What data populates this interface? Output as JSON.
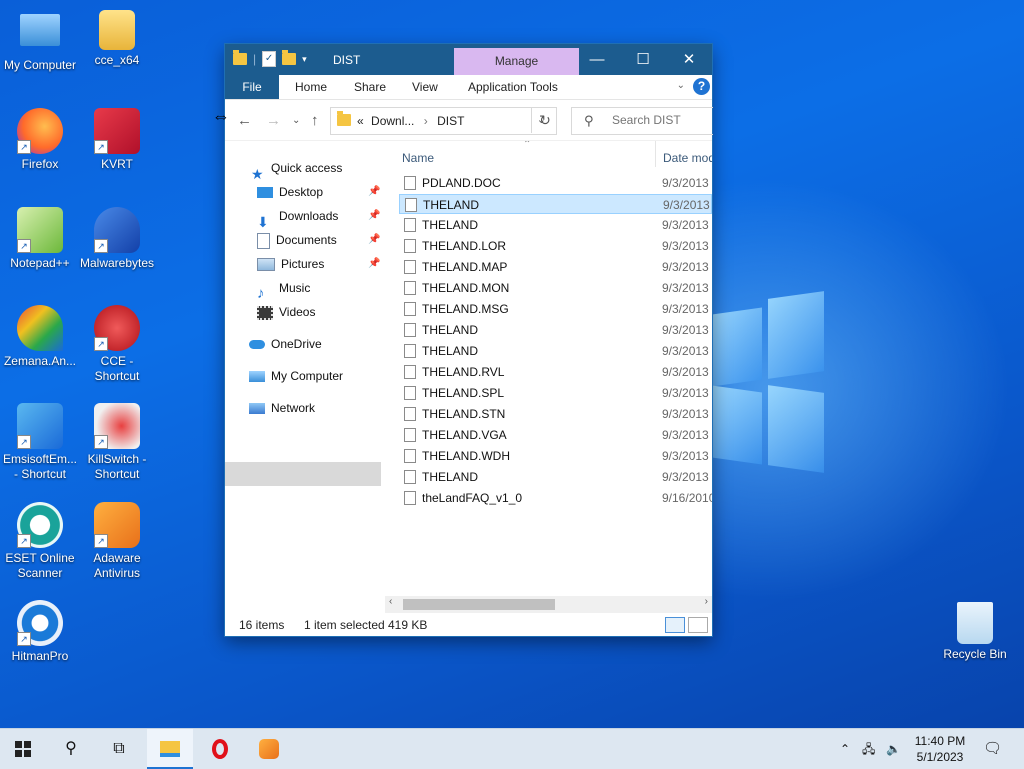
{
  "desktop": {
    "icons": [
      {
        "label": "My Computer",
        "color": "#4aa3e8"
      },
      {
        "label": "cce_x64",
        "color": "#f0c660"
      },
      {
        "label": "Firefox",
        "color": "#e8683a"
      },
      {
        "label": "KVRT",
        "color": "#d2243a"
      },
      {
        "label": "Notepad++",
        "color": "#7cc04e"
      },
      {
        "label": "Malwarebytes",
        "color": "#1b60c8"
      },
      {
        "label": "Zemana.An...",
        "color": "#2e9a4a"
      },
      {
        "label": "CCE - Shortcut",
        "color": "#c8202a"
      },
      {
        "label": "EmsisoftEm... - Shortcut",
        "color": "#2a8ad8"
      },
      {
        "label": "KillSwitch - Shortcut",
        "color": "#c82a2a"
      },
      {
        "label": "ESET Online Scanner",
        "color": "#1aa39a"
      },
      {
        "label": "Adaware Antivirus",
        "color": "#f08a1a"
      },
      {
        "label": "HitmanPro",
        "color": "#1a7ad8"
      },
      {
        "label": "Recycle Bin",
        "color": "#cfe6f7"
      }
    ]
  },
  "explorer": {
    "title": "DIST",
    "manage_label": "Manage",
    "tabs": {
      "file": "File",
      "home": "Home",
      "share": "Share",
      "view": "View",
      "app_tools": "Application Tools"
    },
    "help": "?",
    "address": {
      "prefix": "«",
      "path1": "Downl...",
      "sep": "›",
      "path2": "DIST"
    },
    "search_placeholder": "Search DIST",
    "nav": {
      "quick_access": "Quick access",
      "desktop": "Desktop",
      "downloads": "Downloads",
      "documents": "Documents",
      "pictures": "Pictures",
      "music": "Music",
      "videos": "Videos",
      "onedrive": "OneDrive",
      "my_computer": "My Computer",
      "network": "Network"
    },
    "columns": {
      "name": "Name",
      "date": "Date mod"
    },
    "files": [
      {
        "name": "PDLAND.DOC",
        "date": "9/3/2013"
      },
      {
        "name": "THELAND",
        "date": "9/3/2013"
      },
      {
        "name": "THELAND",
        "date": "9/3/2013"
      },
      {
        "name": "THELAND.LOR",
        "date": "9/3/2013"
      },
      {
        "name": "THELAND.MAP",
        "date": "9/3/2013"
      },
      {
        "name": "THELAND.MON",
        "date": "9/3/2013"
      },
      {
        "name": "THELAND.MSG",
        "date": "9/3/2013"
      },
      {
        "name": "THELAND",
        "date": "9/3/2013"
      },
      {
        "name": "THELAND",
        "date": "9/3/2013"
      },
      {
        "name": "THELAND.RVL",
        "date": "9/3/2013"
      },
      {
        "name": "THELAND.SPL",
        "date": "9/3/2013"
      },
      {
        "name": "THELAND.STN",
        "date": "9/3/2013"
      },
      {
        "name": "THELAND.VGA",
        "date": "9/3/2013"
      },
      {
        "name": "THELAND.WDH",
        "date": "9/3/2013"
      },
      {
        "name": "THELAND",
        "date": "9/3/2013"
      },
      {
        "name": "theLandFAQ_v1_0",
        "date": "9/16/2010"
      }
    ],
    "selected_index": 1,
    "status": {
      "items": "16 items",
      "selected": "1 item selected",
      "size": "419 KB"
    }
  },
  "taskbar": {
    "time": "11:40 PM",
    "date": "5/1/2023"
  },
  "colors": {
    "accent": "#1c5c8f",
    "selection": "#cce8ff",
    "manage": "#d9b8f0"
  }
}
